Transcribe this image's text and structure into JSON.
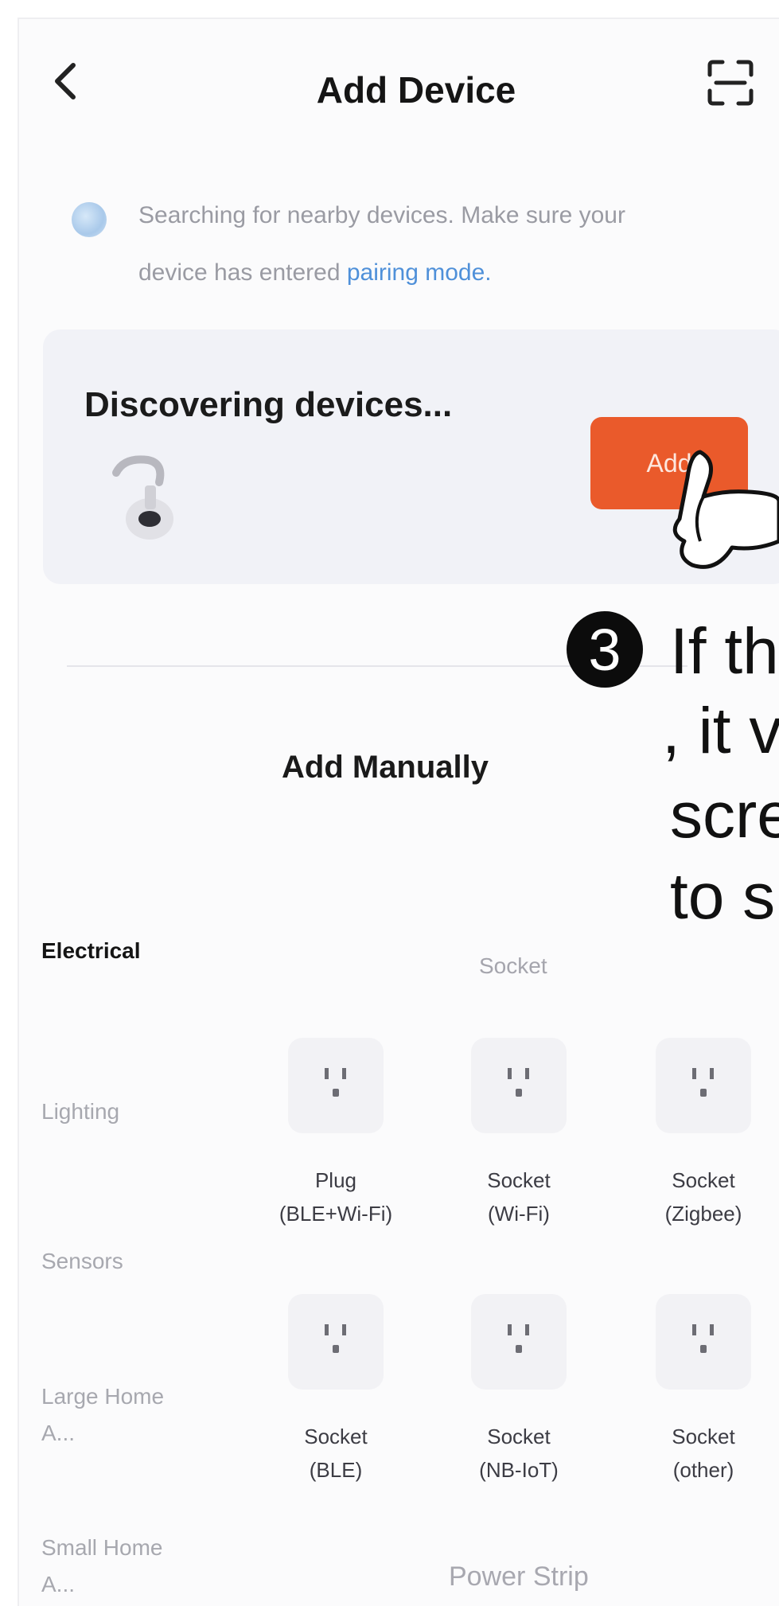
{
  "header": {
    "title": "Add Device",
    "back_icon": "chevron-left-icon",
    "scan_icon": "scan-icon"
  },
  "notice": {
    "line1": "Searching for nearby devices. Make sure your",
    "line2_prefix": "device has entered ",
    "line2_link": "pairing mode."
  },
  "discovery": {
    "title": "Discovering devices...",
    "add_label": "Add",
    "add_color": "#ea5a2b"
  },
  "manual": {
    "title": "Add Manually",
    "categories": [
      "Electrical",
      "Lighting",
      "Sensors",
      "Large Home A...",
      "Small Home A..."
    ],
    "active_category": "Electrical",
    "section_title": "Socket",
    "devices": [
      {
        "label": "Plug\n(BLE+Wi-Fi)"
      },
      {
        "label": "Socket\n(Wi-Fi)"
      },
      {
        "label": "Socket\n(Zigbee)"
      },
      {
        "label": "Socket\n(BLE)"
      },
      {
        "label": "Socket\n(NB-IoT)"
      },
      {
        "label": "Socket\n(other)"
      }
    ],
    "next_section": "Power Strip"
  },
  "annotation": {
    "step": "3",
    "lines": [
      "If th",
      ", it v",
      "scre",
      "to s"
    ]
  }
}
